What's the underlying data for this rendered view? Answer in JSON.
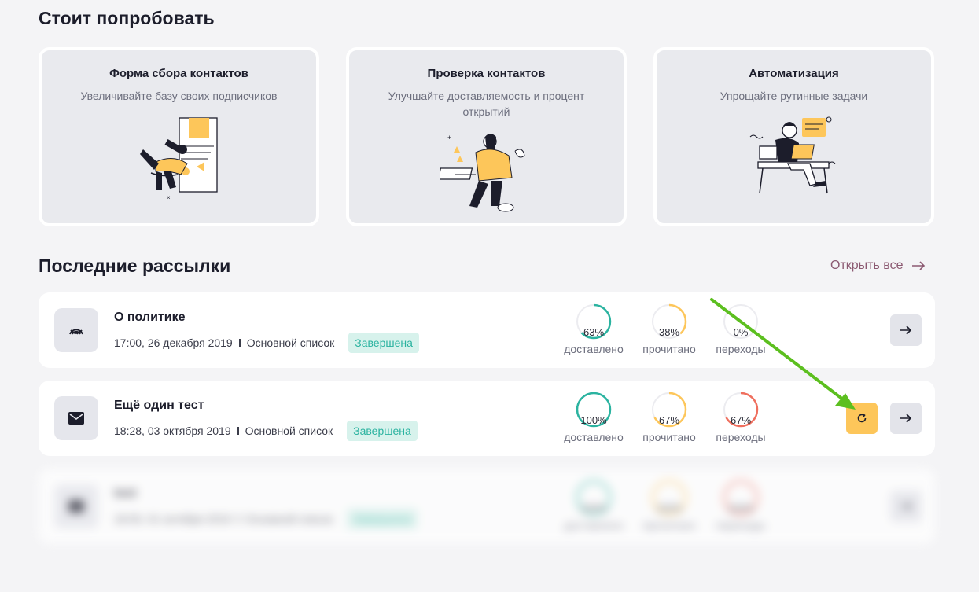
{
  "section_try": {
    "title": "Стоит попробовать"
  },
  "promo_cards": [
    {
      "title": "Форма сбора контактов",
      "subtitle": "Увеличивайте базу своих подписчиков"
    },
    {
      "title": "Проверка контактов",
      "subtitle": "Улучшайте доставляемость и процент открытий"
    },
    {
      "title": "Автоматизация",
      "subtitle": "Упрощайте рутинные задачи"
    }
  ],
  "section_recent": {
    "title": "Последние рассылки",
    "open_all": "Открыть все"
  },
  "campaigns": [
    {
      "title": "О политике",
      "date": "17:00, 26 декабря 2019",
      "list": "Основной список",
      "status": "Завершена",
      "icon": "broadcast-icon",
      "stats": [
        {
          "value": "63%",
          "fraction": 0.63,
          "label": "доставлено",
          "color": "#2bb3a0"
        },
        {
          "value": "38%",
          "fraction": 0.38,
          "label": "прочитано",
          "color": "#fdc65a"
        },
        {
          "value": "0%",
          "fraction": 0.0,
          "label": "переходы",
          "color": "#ef6f5e"
        }
      ]
    },
    {
      "title": "Ещё один тест",
      "date": "18:28, 03 октября 2019",
      "list": "Основной список",
      "status": "Завершена",
      "icon": "envelope-icon",
      "stats": [
        {
          "value": "100%",
          "fraction": 1.0,
          "label": "доставлено",
          "color": "#2bb3a0"
        },
        {
          "value": "67%",
          "fraction": 0.67,
          "label": "прочитано",
          "color": "#fdc65a"
        },
        {
          "value": "67%",
          "fraction": 0.67,
          "label": "переходы",
          "color": "#ef6f5e"
        }
      ]
    },
    {
      "title": "test",
      "date": "18:00, 01 октября 2019",
      "list": "Основной список",
      "status": "Завершена",
      "icon": "envelope-icon",
      "stats": [
        {
          "value": "100%",
          "fraction": 1.0,
          "label": "доставлено",
          "color": "#2bb3a0"
        },
        {
          "value": "100%",
          "fraction": 1.0,
          "label": "прочитано",
          "color": "#fdc65a"
        },
        {
          "value": "100%",
          "fraction": 1.0,
          "label": "переходы",
          "color": "#ef6f5e"
        }
      ]
    }
  ],
  "colors": {
    "accent_green": "#2bb3a0",
    "accent_yellow": "#fdc65a",
    "accent_red": "#ef6f5e",
    "annotation_arrow": "#5cbf1f"
  }
}
